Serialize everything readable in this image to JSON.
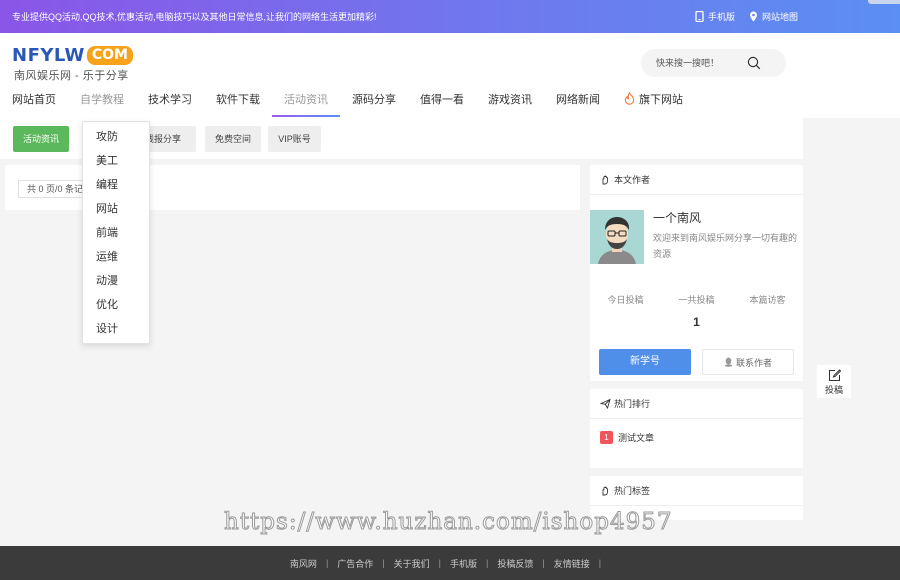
{
  "topbar": {
    "notice": "专业提供QQ活动,QQ技术,优惠活动,电脑技巧以及其他日常信息,让我们的网络生活更加精彩!",
    "mobile_label": "手机版",
    "sitemap_label": "网站地图"
  },
  "header": {
    "logo_main": "NFYLW",
    "logo_com": "COM",
    "slogan": "南风娱乐网 - 乐于分享",
    "search_placeholder": "快来搜一搜吧！"
  },
  "nav": {
    "items": [
      "网站首页",
      "自学教程",
      "技术学习",
      "软件下载",
      "活动资讯",
      "源码分享",
      "值得一看",
      "游戏资讯",
      "网络新闻",
      "旗下网站"
    ]
  },
  "subnav": {
    "items": [
      "活动资讯",
      "线报分享",
      "免费空间",
      "VIP账号"
    ]
  },
  "dropdown": {
    "items": [
      "攻防",
      "美工",
      "编程",
      "网站",
      "前端",
      "运维",
      "动漫",
      "优化",
      "设计"
    ]
  },
  "content": {
    "pager_text": "共 0 页/0 条记录"
  },
  "author": {
    "title": "本文作者",
    "name": "一个南风",
    "desc": "欢迎来到南风娱乐网分享一切有趣的资源",
    "stats": [
      "今日投稿",
      "一共投稿",
      "本篇访客"
    ],
    "total_value": "1",
    "primary_btn": "新学号",
    "contact_btn": "联系作者"
  },
  "hot": {
    "title": "热门排行",
    "items": [
      {
        "rank": "1",
        "title": "测试文章"
      }
    ]
  },
  "tags": {
    "title": "热门标签"
  },
  "float_submit": "投稿",
  "watermark": "https://www.huzhan.com/ishop4957",
  "footer": {
    "links": [
      "南风网",
      "广告合作",
      "关于我们",
      "手机版",
      "投稿反馈",
      "友情链接"
    ]
  },
  "colors": {
    "topbar_start": "#8a56e8",
    "topbar_end": "#5b8ff1",
    "logo_blue": "#2a58b8",
    "logo_orange": "#f7a21b",
    "green_button": "#5cb85c",
    "primary_blue": "#4f8fea",
    "rank_red": "#f2545b",
    "footer_bg": "#3b3b3b"
  }
}
